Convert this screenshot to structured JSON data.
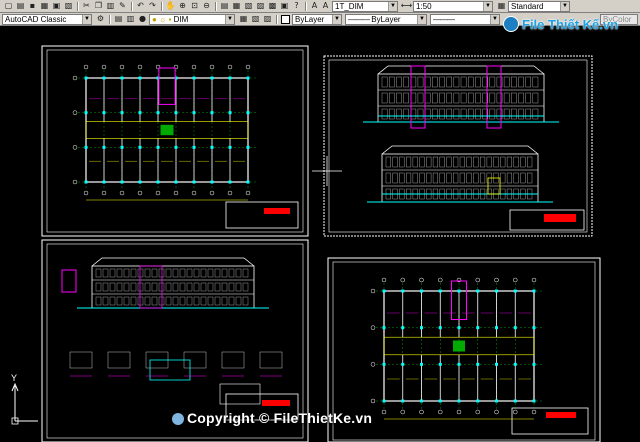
{
  "toolbar_top": {
    "text_style": "1T_DIM",
    "scale": "1:50",
    "table_style": "Standard"
  },
  "toolbar_second": {
    "workspace": "AutoCAD Classic",
    "layer": "DIM",
    "color": "ByLayer",
    "linetype": "ByLayer",
    "lineweight_fragment": "ByColor"
  },
  "brand": {
    "name": "File Thiết Kế.vn"
  },
  "watermark": {
    "copyright": "Copyright © FileThietKe.vn",
    "site": "FileThietKe.vn"
  },
  "sheets": [
    {
      "name": "ground-floor-plan",
      "border_color": "#ffffff"
    },
    {
      "name": "elevation-sheet",
      "border_color": "#ffffff"
    },
    {
      "name": "section-sheet",
      "border_color": "#ffffff"
    },
    {
      "name": "upper-floor-plan",
      "border_color": "#ffffff"
    }
  ],
  "colors": {
    "canvas": "#000000",
    "wall": "#ffffff",
    "column": "#00ffff",
    "grid": "#00ff00",
    "accent": "#ff00ff",
    "dim": "#ffff00",
    "title_red": "#ff0000"
  },
  "ucs": {
    "y_label": "Y"
  }
}
